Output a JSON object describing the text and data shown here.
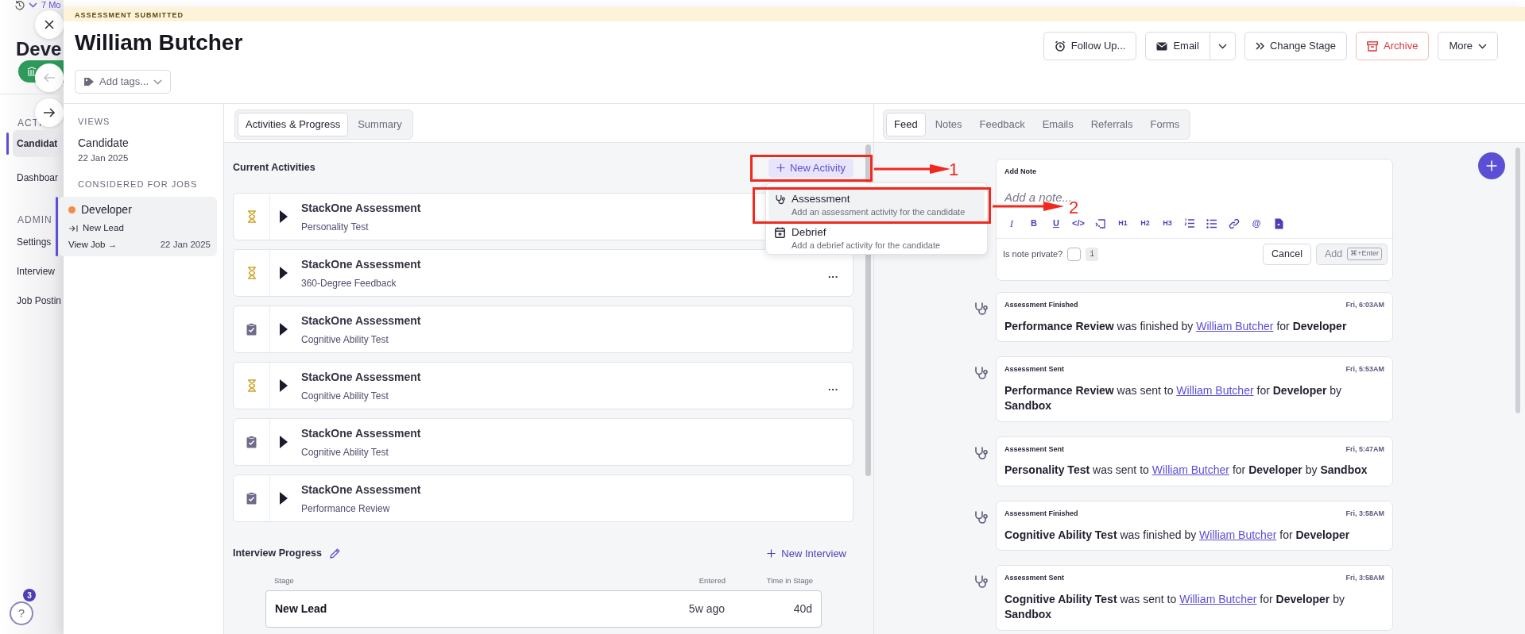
{
  "background_app": {
    "history_label": "7 Mo",
    "title": "Deve",
    "section_label": "ACTI",
    "nav_items": [
      {
        "label": "Candidat",
        "selected": true
      },
      {
        "label": "Dashboar",
        "selected": false
      }
    ],
    "admin_label": "ADMIN",
    "admin_items": [
      {
        "label": "Settings",
        "selected": false
      },
      {
        "label": "Interview",
        "selected": false
      },
      {
        "label": "Job Postin",
        "selected": false
      }
    ],
    "help_label": "?",
    "help_badge": "3"
  },
  "panel_nav": [
    {
      "kind": "close"
    },
    {
      "kind": "back",
      "disabled": true
    },
    {
      "kind": "forward",
      "disabled": false
    }
  ],
  "banner": "ASSESSMENT SUBMITTED",
  "candidate_name": "William Butcher",
  "tags_placeholder": "Add tags...",
  "actions": [
    {
      "kind": "follow-up",
      "label": "Follow Up..."
    },
    {
      "kind": "email",
      "label": "Email"
    },
    {
      "kind": "change-stage",
      "label": "Change Stage"
    },
    {
      "kind": "archive",
      "label": "Archive"
    },
    {
      "kind": "more",
      "label": "More"
    }
  ],
  "views": {
    "heading": "VIEWS",
    "items": [
      {
        "label": "Candidate",
        "date": "22 Jan 2025"
      }
    ]
  },
  "jobs": {
    "heading": "CONSIDERED FOR JOBS",
    "items": [
      {
        "title": "Developer",
        "color": "#f28c4b",
        "stage": "New Lead",
        "link": "View Job →",
        "date": "22 Jan 2025",
        "selected": true
      }
    ]
  },
  "left_tabs": [
    {
      "label": "Activities & Progress",
      "selected": true
    },
    {
      "label": "Summary",
      "selected": false
    }
  ],
  "current_activities": {
    "heading": "Current Activities",
    "new_button": "New Activity",
    "items": [
      {
        "title": "StackOne Assessment",
        "subtitle": "Personality Test",
        "completed": false
      },
      {
        "title": "StackOne Assessment",
        "subtitle": "360-Degree Feedback",
        "completed": false,
        "menu": "···"
      },
      {
        "title": "StackOne Assessment",
        "subtitle": "Cognitive Ability Test",
        "completed": true
      },
      {
        "title": "StackOne Assessment",
        "subtitle": "Cognitive Ability Test",
        "completed": false,
        "menu": "···"
      },
      {
        "title": "StackOne Assessment",
        "subtitle": "Cognitive Ability Test",
        "completed": true
      },
      {
        "title": "StackOne Assessment",
        "subtitle": "Performance Review",
        "completed": true
      }
    ]
  },
  "new_activity_menu": [
    {
      "kind": "assessment",
      "title": "Assessment",
      "description": "Add an assessment activity for the candidate",
      "selected": true
    },
    {
      "kind": "debrief",
      "title": "Debrief",
      "description": "Add a debrief activity for the candidate",
      "selected": false
    }
  ],
  "interview_progress": {
    "heading": "Interview Progress",
    "new_button": "New Interview",
    "columns": [
      "Stage",
      "Entered",
      "Time in Stage"
    ],
    "rows": [
      {
        "stage": "New Lead",
        "entered": "5w ago",
        "time_in_stage": "40d"
      }
    ]
  },
  "right_tabs": [
    {
      "label": "Feed",
      "selected": true
    },
    {
      "label": "Notes",
      "selected": false
    },
    {
      "label": "Feedback",
      "selected": false
    },
    {
      "label": "Emails",
      "selected": false
    },
    {
      "label": "Referrals",
      "selected": false
    },
    {
      "label": "Forms",
      "selected": false
    }
  ],
  "note_editor": {
    "label": "Add Note",
    "placeholder": "Add a note...",
    "toolbar": [
      {
        "kind": "italic",
        "label": "I"
      },
      {
        "kind": "bold",
        "label": "B"
      },
      {
        "kind": "underline",
        "label": "U"
      },
      {
        "kind": "code",
        "label": "</>"
      },
      {
        "kind": "code-block"
      },
      {
        "kind": "heading",
        "label": "H1"
      },
      {
        "kind": "heading",
        "label": "H2"
      },
      {
        "kind": "heading",
        "label": "H3"
      },
      {
        "kind": "ordered-list"
      },
      {
        "kind": "bullet-list"
      },
      {
        "kind": "link"
      },
      {
        "kind": "mention",
        "label": "@"
      },
      {
        "kind": "file"
      }
    ],
    "private_label": "Is note private?",
    "private": false,
    "info": "i",
    "cancel": "Cancel",
    "add": "Add",
    "add_disabled": true,
    "shortcut": "⌘+Enter"
  },
  "feed": [
    {
      "title": "Assessment Finished",
      "time": "Fri, 6:03AM",
      "before": "**Performance Review** was finished by",
      "link": "William Butcher",
      "after": "for **Developer**"
    },
    {
      "title": "Assessment Sent",
      "time": "Fri, 5:53AM",
      "before": "**Performance Review** was sent to",
      "link": "William Butcher",
      "after": "for **Developer** by **Sandbox**"
    },
    {
      "title": "Assessment Sent",
      "time": "Fri, 5:47AM",
      "before": "**Personality Test** was sent to",
      "link": "William Butcher",
      "after": "for **Developer** by **Sandbox**"
    },
    {
      "title": "Assessment Finished",
      "time": "Fri, 3:58AM",
      "before": "**Cognitive Ability Test** was finished by",
      "link": "William Butcher",
      "after": "for **Developer**"
    },
    {
      "title": "Assessment Sent",
      "time": "Fri, 3:58AM",
      "before": "**Cognitive Ability Test** was sent to",
      "link": "William Butcher",
      "after": "for **Developer** by **Sandbox**"
    }
  ],
  "annotations": [
    {
      "number": "1"
    },
    {
      "number": "2"
    }
  ]
}
